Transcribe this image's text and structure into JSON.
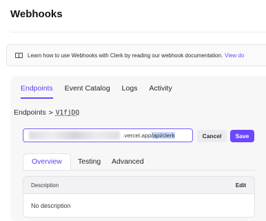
{
  "page": {
    "title": "Webhooks"
  },
  "banner": {
    "text": "Learn how to use Webhooks with Clerk by reading our webhook documentation.",
    "link": "View do"
  },
  "tabs": [
    {
      "label": "Endpoints",
      "active": true
    },
    {
      "label": "Event Catalog",
      "active": false
    },
    {
      "label": "Logs",
      "active": false
    },
    {
      "label": "Activity",
      "active": false
    }
  ],
  "breadcrumb": {
    "root": "Endpoints",
    "separator": ">",
    "id": "V1fjDQ"
  },
  "url_input": {
    "visible_text": ".vercel.app",
    "selected_text": "/api/clerk"
  },
  "buttons": {
    "cancel": "Cancel",
    "save": "Save"
  },
  "subtabs": [
    {
      "label": "Overview",
      "active": true
    },
    {
      "label": "Testing",
      "active": false
    },
    {
      "label": "Advanced",
      "active": false
    }
  ],
  "description_card": {
    "header": "Description",
    "edit_label": "Edit",
    "body": "No description"
  },
  "colors": {
    "accent": "#6c47ff",
    "panel_bg": "#f7f7f8"
  }
}
